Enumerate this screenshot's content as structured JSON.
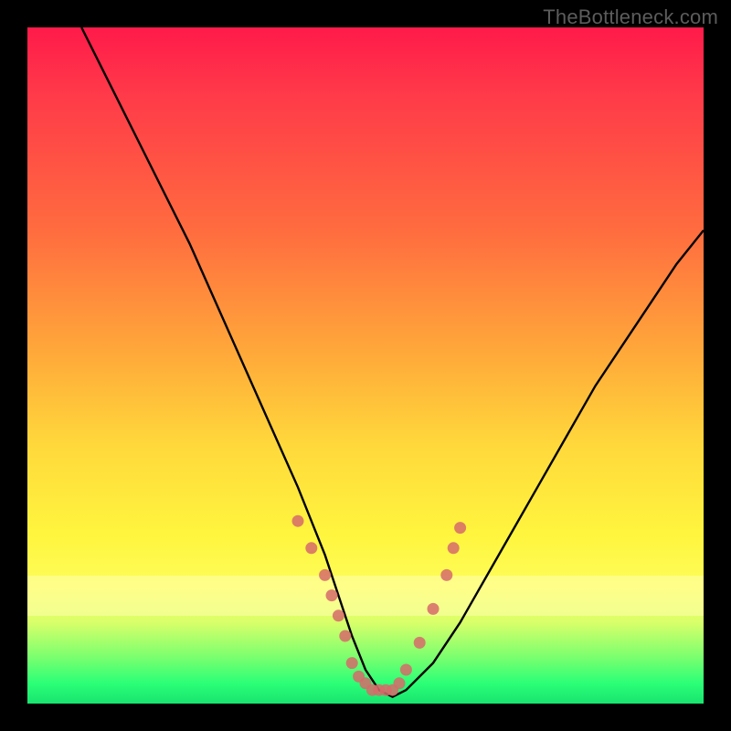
{
  "attribution": "TheBottleneck.com",
  "chart_data": {
    "type": "line",
    "title": "",
    "xlabel": "",
    "ylabel": "",
    "xlim": [
      0,
      100
    ],
    "ylim": [
      0,
      100
    ],
    "series": [
      {
        "name": "bottleneck-curve",
        "x": [
          8,
          12,
          16,
          20,
          24,
          28,
          32,
          36,
          40,
          44,
          46,
          48,
          50,
          52,
          54,
          56,
          60,
          64,
          68,
          72,
          76,
          80,
          84,
          88,
          92,
          96,
          100
        ],
        "y": [
          100,
          92,
          84,
          76,
          68,
          59,
          50,
          41,
          32,
          22,
          16,
          10,
          5,
          2,
          1,
          2,
          6,
          12,
          19,
          26,
          33,
          40,
          47,
          53,
          59,
          65,
          70
        ]
      }
    ],
    "markers": {
      "name": "salmon-dots",
      "color": "#d66a6a",
      "x": [
        40,
        42,
        44,
        45,
        46,
        47,
        48,
        49,
        50,
        51,
        52,
        53,
        54,
        55,
        56,
        58,
        60,
        62,
        63,
        64
      ],
      "y": [
        27,
        23,
        19,
        16,
        13,
        10,
        6,
        4,
        3,
        2,
        2,
        2,
        2,
        3,
        5,
        9,
        14,
        19,
        23,
        26
      ]
    },
    "background_gradient": {
      "top": "#ff1a4a",
      "upper_mid": "#ffa83a",
      "mid": "#fff53e",
      "lower": "#2bff77"
    }
  }
}
